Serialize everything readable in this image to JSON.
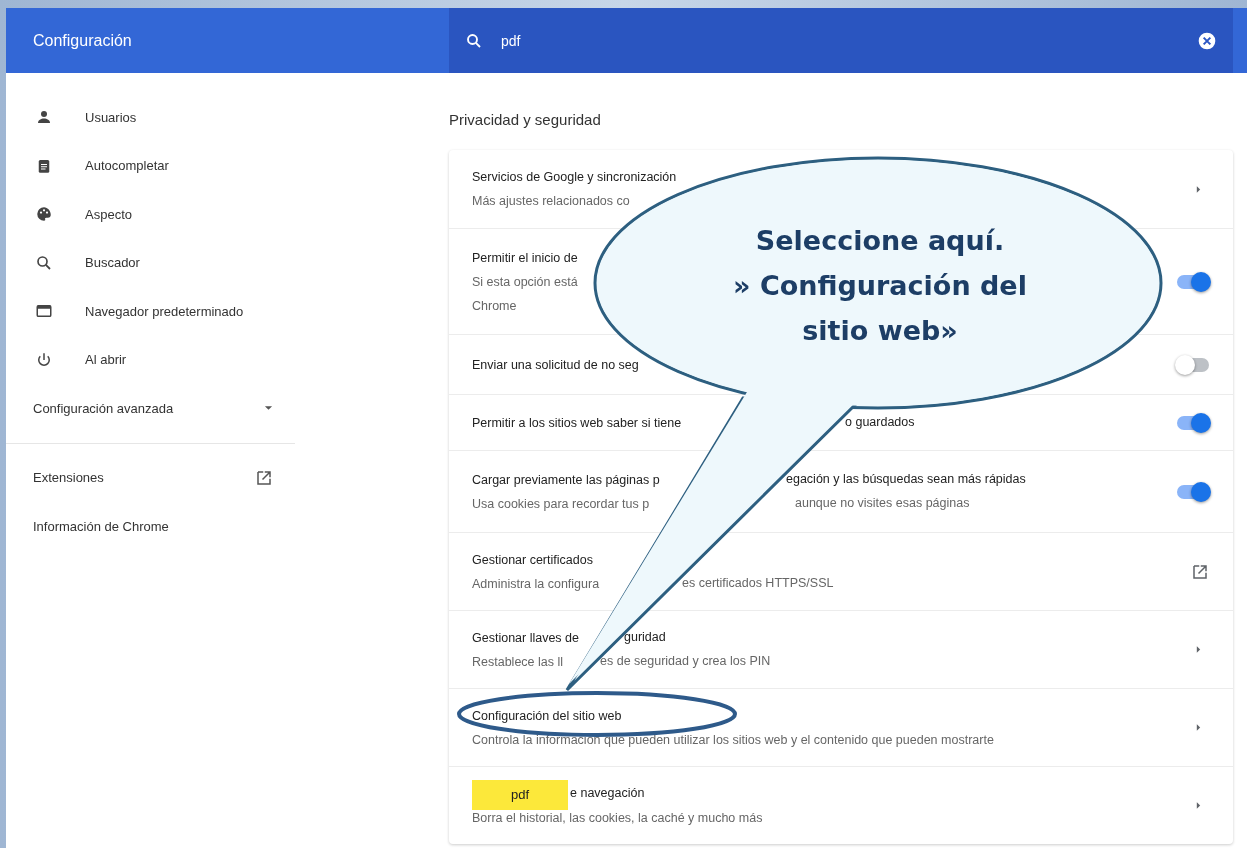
{
  "header": {
    "title": "Configuración",
    "search": {
      "value": "pdf"
    }
  },
  "sidebar": {
    "items": [
      {
        "kind": "page",
        "label": "Usuarios"
      },
      {
        "kind": "page",
        "label": "Autocompletar"
      },
      {
        "kind": "page",
        "label": "Aspecto"
      },
      {
        "kind": "page",
        "label": "Buscador"
      },
      {
        "kind": "page",
        "label": "Navegador predeterminado"
      },
      {
        "kind": "page",
        "label": "Al abrir"
      },
      {
        "kind": "section",
        "label": "Configuración avanzada",
        "expanded": false
      },
      {
        "kind": "external",
        "label": "Extensiones"
      },
      {
        "kind": "plain",
        "label": "Información de Chrome"
      }
    ]
  },
  "section": {
    "heading": "Privacidad y seguridad",
    "rows": [
      {
        "title": "Servicios de Google y sincronización",
        "desc": "Más ajustes relacionados co",
        "kind": "arrow"
      },
      {
        "title": "Permitir el inicio de",
        "desc": "Si esta opción está",
        "desc_line2": "Chrome",
        "kind": "toggle",
        "on": true
      },
      {
        "title": "Enviar una solicitud de no seg",
        "kind": "toggle",
        "on": false
      },
      {
        "title": "Permitir a los sitios web saber si tiene",
        "title_tail": "o guardados",
        "kind": "toggle",
        "on": true
      },
      {
        "title": "Cargar previamente las páginas p",
        "title_tail": "egación y las búsquedas sean más rápidas",
        "desc": "Usa cookies para recordar tus p",
        "desc_tail": "aunque no visites esas páginas",
        "kind": "toggle",
        "on": true
      },
      {
        "title": "Gestionar certificados",
        "desc": "Administra la configura",
        "desc_tail": "es certificados HTTPS/SSL",
        "kind": "external"
      },
      {
        "title": "Gestionar llaves de",
        "title_tail": "guridad",
        "desc": "Restablece las ll",
        "desc_tail": "es de seguridad y crea los PIN",
        "kind": "arrow"
      },
      {
        "title": "Configuración del sitio web",
        "desc": "Controla la información que pueden utilizar los sitios web y el contenido que pueden mostrarte",
        "kind": "arrow",
        "circled": true
      },
      {
        "title_tail": "e navegación",
        "desc": "Borra el historial, las cookies, la caché y mucho más",
        "kind": "arrow",
        "badge": "pdf"
      }
    ]
  },
  "callout": {
    "lines": [
      "Seleccione aquí.",
      "» Configuración del",
      "sitio web»"
    ]
  }
}
